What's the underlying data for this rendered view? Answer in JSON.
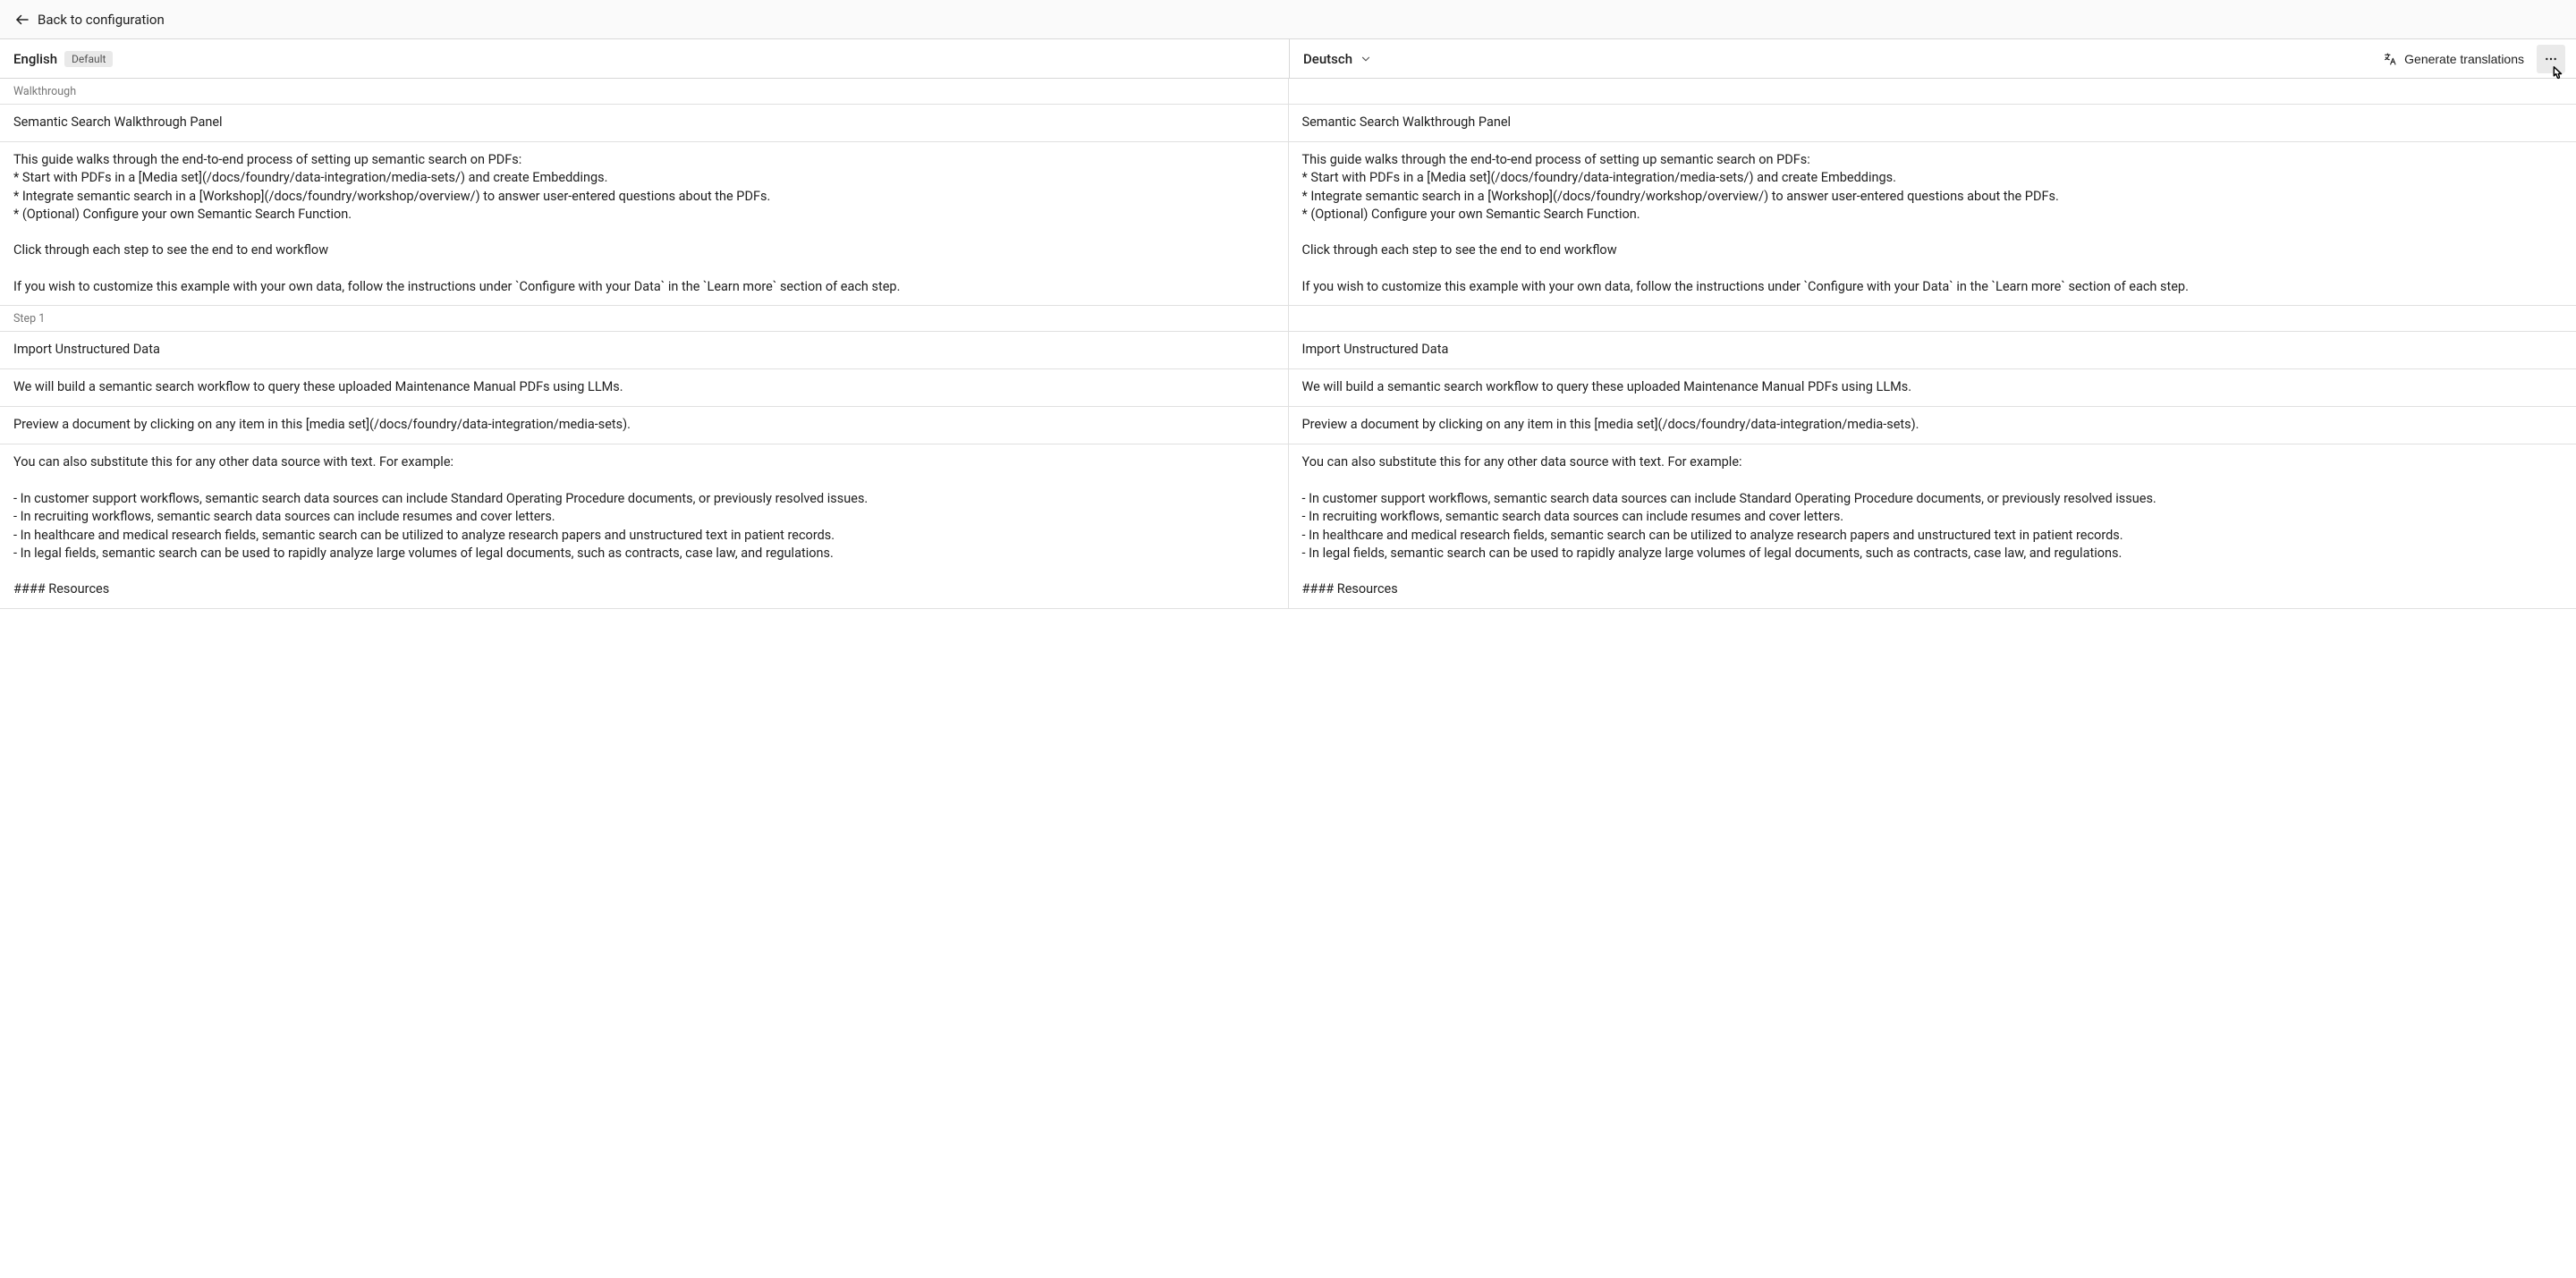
{
  "topbar": {
    "back_label": "Back to configuration"
  },
  "header": {
    "left_lang": "English",
    "default_badge": "Default",
    "right_lang": "Deutsch",
    "generate_label": "Generate translations"
  },
  "sections": [
    {
      "label": "Walkthrough",
      "rows": [
        {
          "en": "Semantic Search Walkthrough Panel",
          "de": "Semantic Search Walkthrough Panel"
        },
        {
          "en": "This guide walks through the end-to-end process of setting up semantic search on PDFs:\n* Start with PDFs in a [Media set](/docs/foundry/data-integration/media-sets/) and create Embeddings.\n* Integrate semantic search in a [Workshop](/docs/foundry/workshop/overview/) to answer user-entered questions about the PDFs.\n* (Optional) Configure your own Semantic Search Function.\n\nClick through each step to see the end to end workflow\n\nIf you wish to customize this example with your own data, follow the instructions under `Configure with your Data` in the `Learn more` section of each step.",
          "de": "This guide walks through the end-to-end process of setting up semantic search on PDFs:\n* Start with PDFs in a [Media set](/docs/foundry/data-integration/media-sets/) and create Embeddings.\n* Integrate semantic search in a [Workshop](/docs/foundry/workshop/overview/) to answer user-entered questions about the PDFs.\n* (Optional) Configure your own Semantic Search Function.\n\nClick through each step to see the end to end workflow\n\nIf you wish to customize this example with your own data, follow the instructions under `Configure with your Data` in the `Learn more` section of each step."
        }
      ]
    },
    {
      "label": "Step 1",
      "rows": [
        {
          "en": "Import Unstructured Data",
          "de": "Import Unstructured Data"
        },
        {
          "en": "We will build a semantic search workflow to query these uploaded Maintenance Manual PDFs using LLMs.",
          "de": "We will build a semantic search workflow to query these uploaded Maintenance Manual PDFs using LLMs."
        },
        {
          "en": "Preview a document by clicking on any item in this [media set](/docs/foundry/data-integration/media-sets).",
          "de": "Preview a document by clicking on any item in this [media set](/docs/foundry/data-integration/media-sets)."
        },
        {
          "en": "You can also substitute this for any other data source with text. For example:\n\n- In customer support workflows, semantic search data sources can include Standard Operating Procedure documents, or previously resolved issues.\n- In recruiting workflows, semantic search data sources can include resumes and cover letters.\n- In healthcare and medical research fields, semantic search can be utilized to analyze research papers and unstructured text in patient records.\n- In legal fields, semantic search can be used to rapidly analyze large volumes of legal documents, such as contracts, case law, and regulations.\n\n#### Resources",
          "de": "You can also substitute this for any other data source with text. For example:\n\n- In customer support workflows, semantic search data sources can include Standard Operating Procedure documents, or previously resolved issues.\n- In recruiting workflows, semantic search data sources can include resumes and cover letters.\n- In healthcare and medical research fields, semantic search can be utilized to analyze research papers and unstructured text in patient records.\n- In legal fields, semantic search can be used to rapidly analyze large volumes of legal documents, such as contracts, case law, and regulations.\n\n#### Resources"
        }
      ]
    }
  ]
}
